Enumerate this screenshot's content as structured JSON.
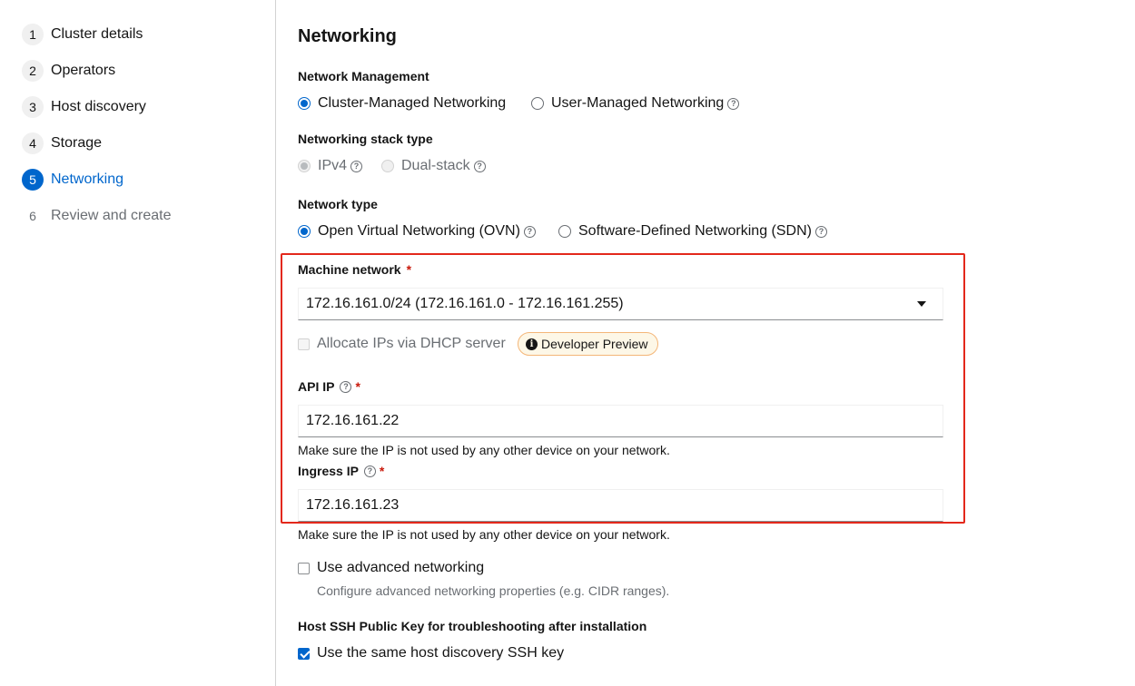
{
  "wizard": {
    "steps": [
      {
        "num": "1",
        "label": "Cluster details"
      },
      {
        "num": "2",
        "label": "Operators"
      },
      {
        "num": "3",
        "label": "Host discovery"
      },
      {
        "num": "4",
        "label": "Storage"
      },
      {
        "num": "5",
        "label": "Networking"
      },
      {
        "num": "6",
        "label": "Review and create"
      }
    ],
    "current_step": "5"
  },
  "page": {
    "title": "Networking",
    "network_management": {
      "label": "Network Management",
      "options": [
        "Cluster-Managed Networking",
        "User-Managed Networking"
      ],
      "selected": "Cluster-Managed Networking"
    },
    "stack_type": {
      "label": "Networking stack type",
      "options": [
        "IPv4",
        "Dual-stack"
      ],
      "selected": "IPv4"
    },
    "network_type": {
      "label": "Network type",
      "options": [
        "Open Virtual Networking (OVN)",
        "Software-Defined Networking (SDN)"
      ],
      "selected": "Open Virtual Networking (OVN)"
    },
    "machine_network": {
      "label": "Machine network",
      "required_mark": "*",
      "value": "172.16.161.0/24 (172.16.161.0 - 172.16.161.255)"
    },
    "dhcp": {
      "label": "Allocate IPs via DHCP server",
      "checked": false,
      "badge_icon": "i",
      "badge": "Developer Preview"
    },
    "api_ip": {
      "label": "API IP",
      "required_mark": "*",
      "value": "172.16.161.22",
      "helper": "Make sure the IP is not used by any other device on your network."
    },
    "ingress_ip": {
      "label": "Ingress IP",
      "required_mark": "*",
      "value": "172.16.161.23",
      "helper": "Make sure the IP is not used by any other device on your network."
    },
    "advanced": {
      "label": "Use advanced networking",
      "checked": false,
      "description": "Configure advanced networking properties (e.g. CIDR ranges)."
    },
    "ssh": {
      "heading": "Host SSH Public Key for troubleshooting after installation",
      "checkbox_label": "Use the same host discovery SSH key",
      "checked": true
    }
  },
  "icons": {
    "help": "?",
    "highlight_color": "#e3281b",
    "accent": "#0066cc"
  }
}
